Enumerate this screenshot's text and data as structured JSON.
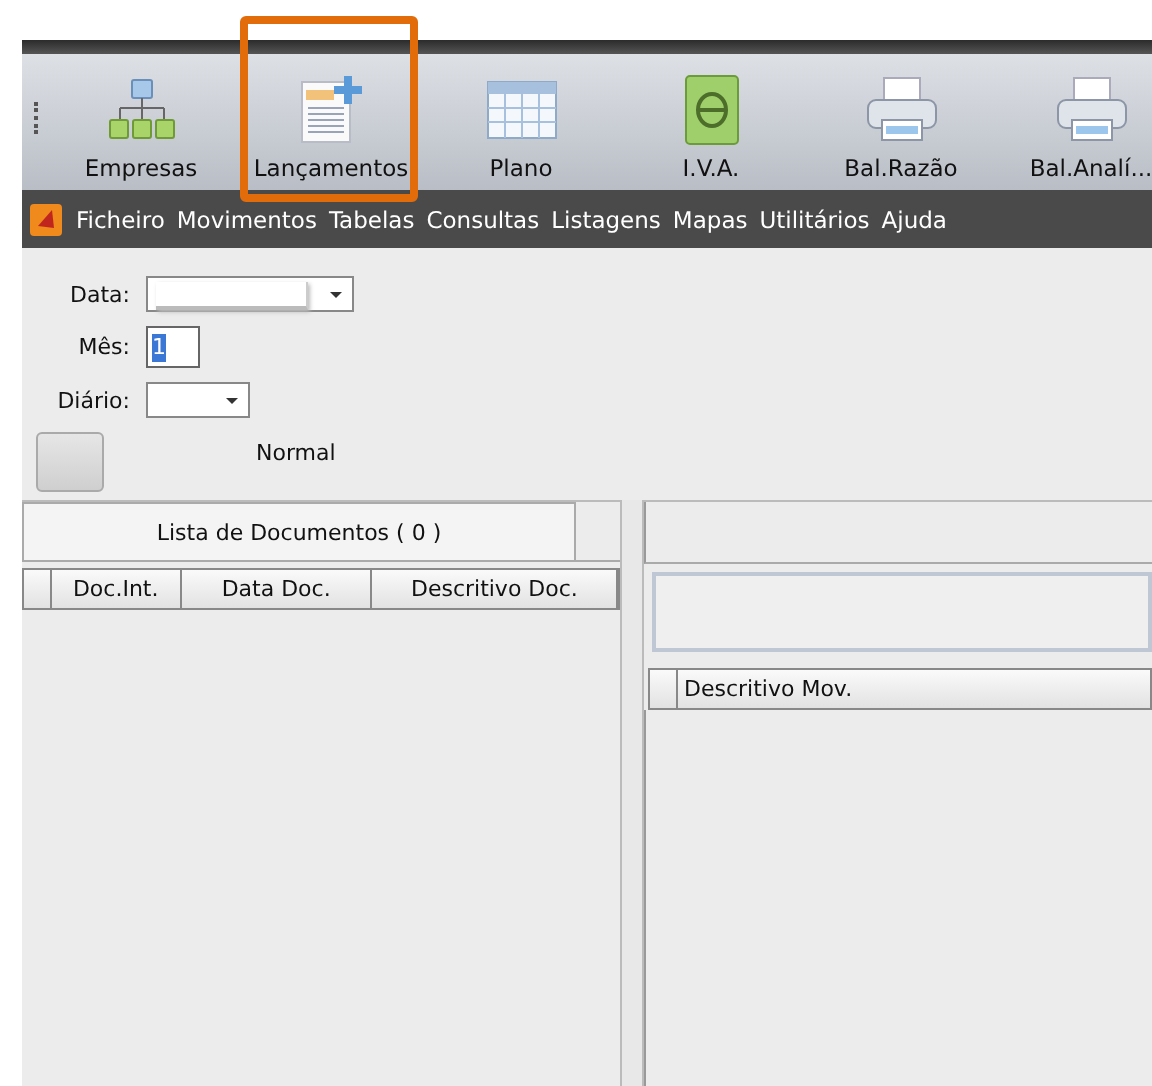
{
  "toolbar": {
    "items": [
      {
        "label": "Empresas",
        "kind": "org",
        "highlighted": false
      },
      {
        "label": "Lançamentos",
        "kind": "doc",
        "highlighted": true
      },
      {
        "label": "Plano",
        "kind": "grid",
        "highlighted": false
      },
      {
        "label": "I.V.A.",
        "kind": "book",
        "highlighted": false
      },
      {
        "label": "Bal.Razão",
        "kind": "printer",
        "highlighted": false
      },
      {
        "label": "Bal.Analí...",
        "kind": "printer",
        "highlighted": false
      }
    ]
  },
  "menu": {
    "items": [
      "Ficheiro",
      "Movimentos",
      "Tabelas",
      "Consultas",
      "Listagens",
      "Mapas",
      "Utilitários",
      "Ajuda"
    ]
  },
  "form": {
    "data_label": "Data:",
    "mes_label": "Mês:",
    "mes_value": "1",
    "diario_label": "Diário:",
    "mode": "Normal"
  },
  "left_pane": {
    "tab": "Lista de Documentos ( 0 )",
    "columns": [
      "Doc.Int.",
      "Data Doc.",
      "Descritivo Doc."
    ]
  },
  "right_pane": {
    "columns": [
      "Descritivo Mov."
    ]
  }
}
